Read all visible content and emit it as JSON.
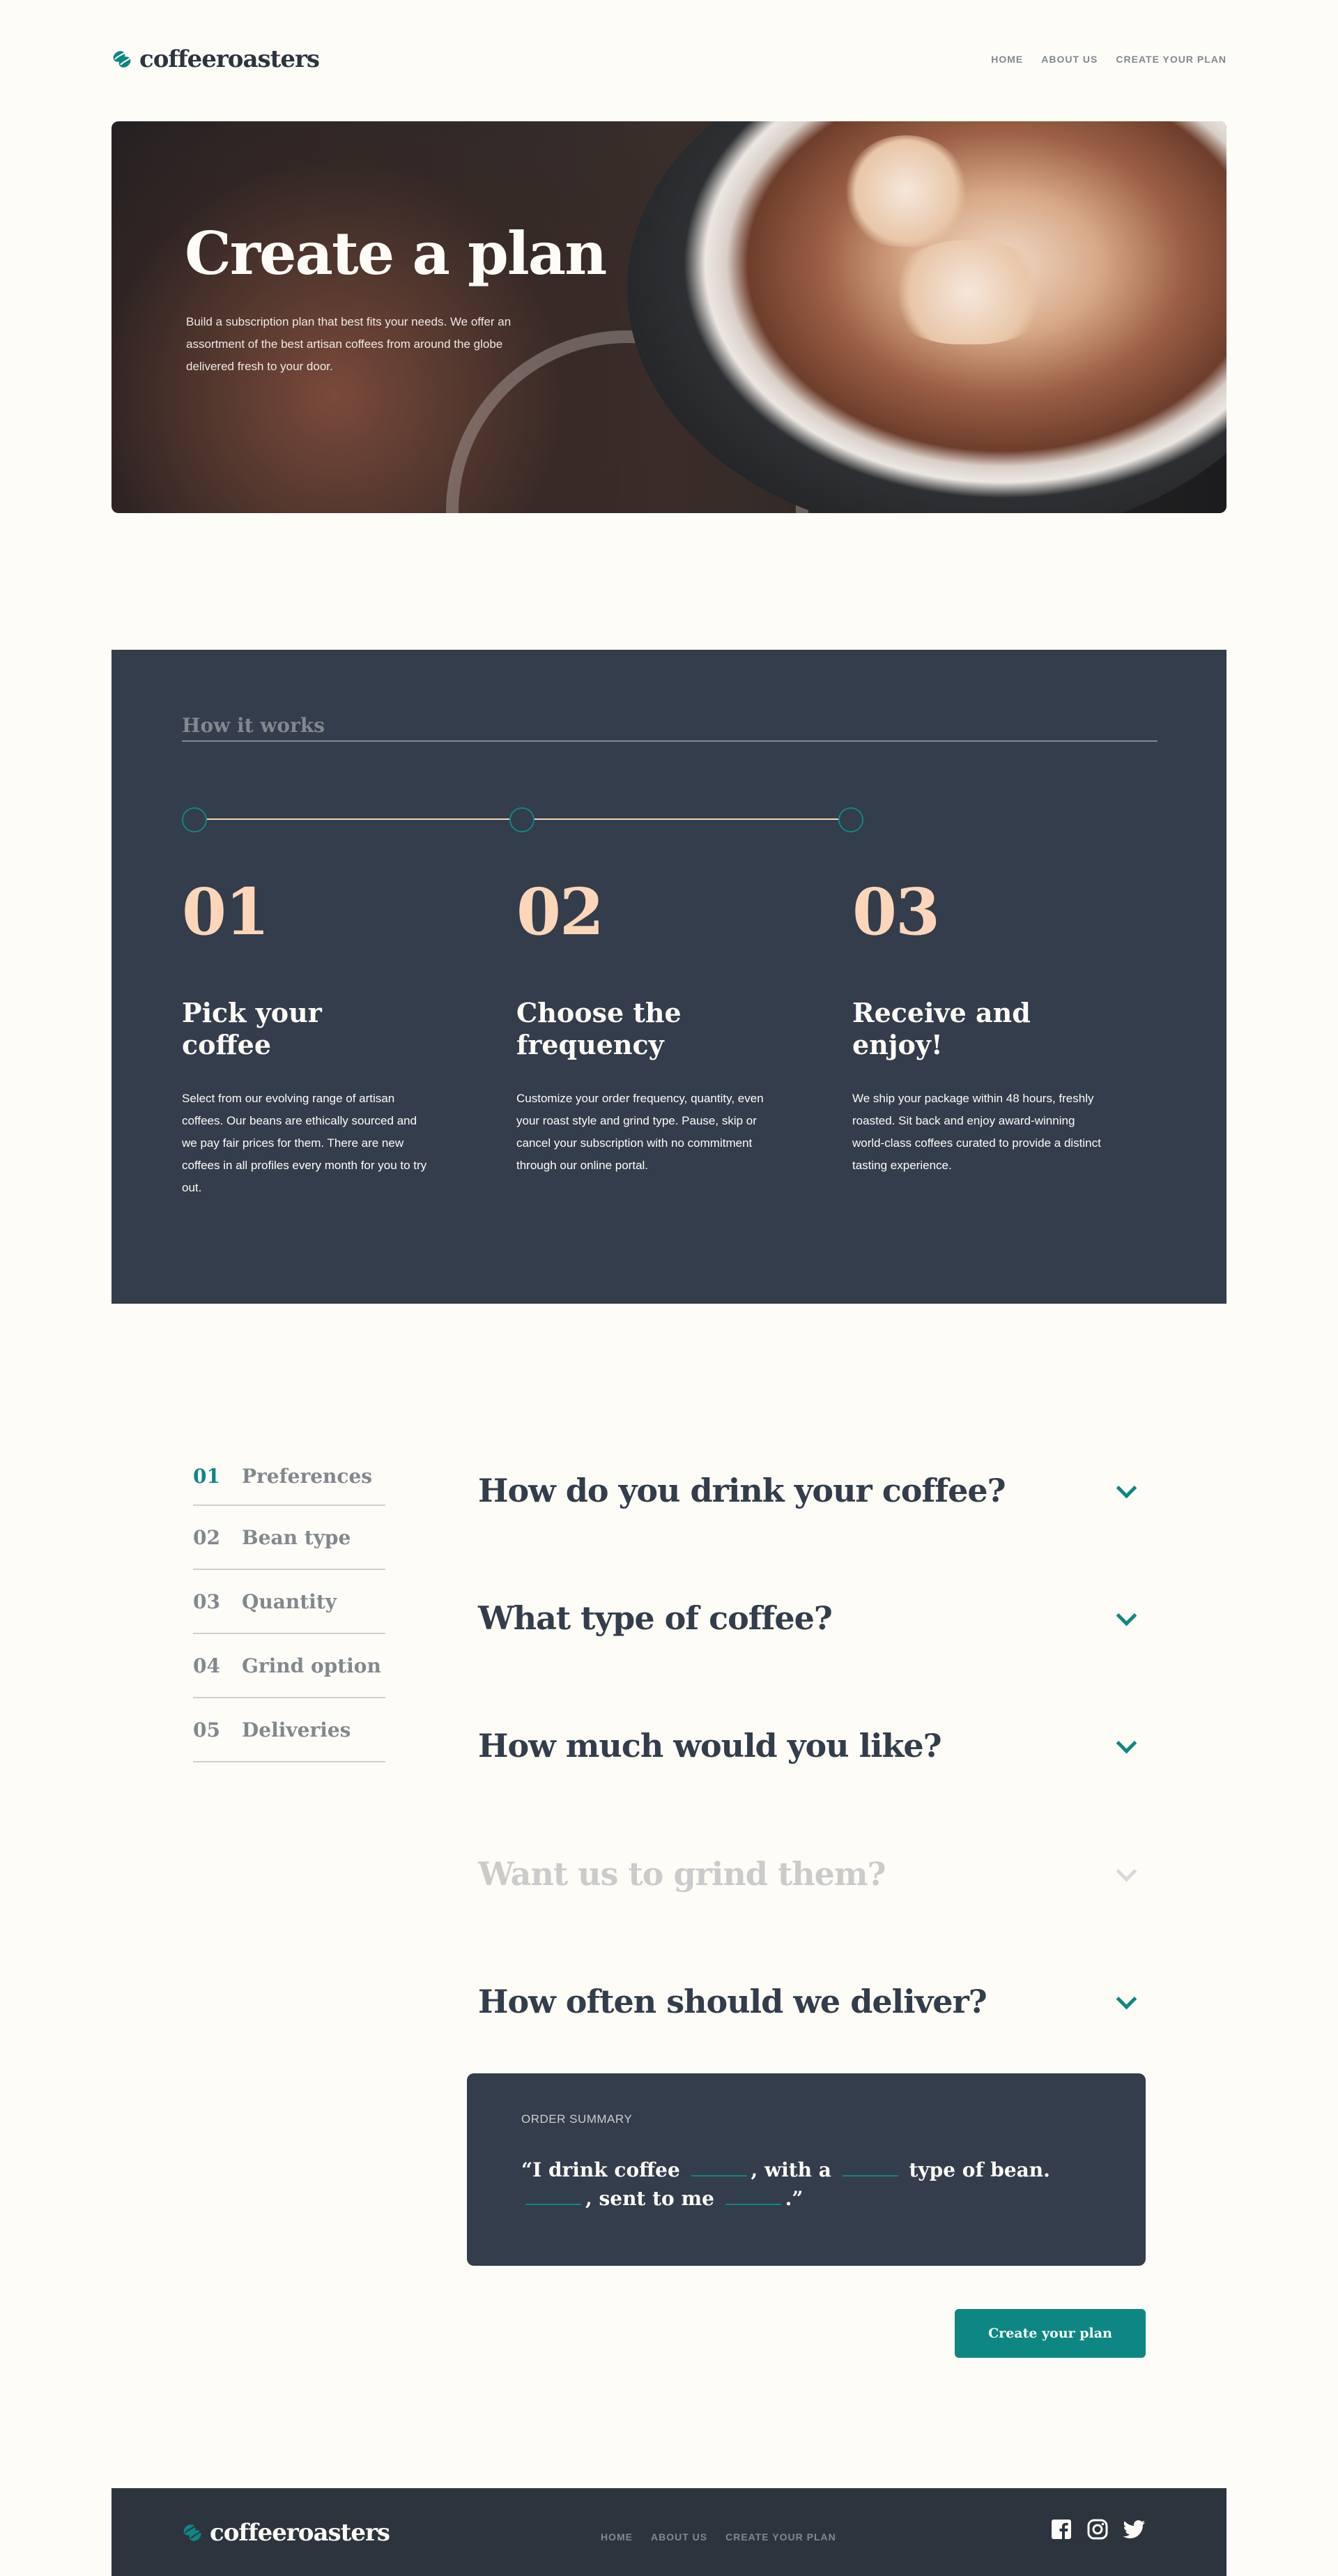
{
  "brand": {
    "name": "coffeeroasters",
    "accent": "#0E8784",
    "dark": "#333D4B",
    "peach": "#FDD6BA"
  },
  "nav": {
    "items": [
      "HOME",
      "ABOUT US",
      "CREATE YOUR PLAN"
    ]
  },
  "hero": {
    "title": "Create a plan",
    "description": "Build a subscription plan that best fits your needs. We offer an assortment of the best artisan coffees from around the globe delivered fresh to your door."
  },
  "how": {
    "title": "How it works",
    "steps": [
      {
        "num": "01",
        "title": "Pick your coffee",
        "desc": "Select from our evolving range of artisan coffees. Our beans are ethically sourced and we pay fair prices for them. There are new coffees in all profiles every month for you to try out."
      },
      {
        "num": "02",
        "title": "Choose the frequency",
        "desc": "Customize your order frequency, quantity, even your roast style and grind type. Pause, skip or cancel your subscription with no commitment through our online portal."
      },
      {
        "num": "03",
        "title": "Receive and enjoy!",
        "desc": "We ship your package within 48 hours, freshly roasted. Sit back and enjoy award-winning world-class coffees curated to provide a distinct tasting experience."
      }
    ]
  },
  "sidebar": {
    "items": [
      {
        "num": "01",
        "label": "Preferences"
      },
      {
        "num": "02",
        "label": "Bean type"
      },
      {
        "num": "03",
        "label": "Quantity"
      },
      {
        "num": "04",
        "label": "Grind option"
      },
      {
        "num": "05",
        "label": "Deliveries"
      }
    ]
  },
  "questions": [
    "How do you drink your coffee?",
    "What type of coffee?",
    "How much would you like?",
    "Want us to grind them?",
    "How often should we deliver?"
  ],
  "order": {
    "label": "ORDER SUMMARY",
    "open_quote": "“I drink coffee",
    "part2": ", with a",
    "part3": "type of bean.",
    "part4": ",",
    "part5": "sent to me",
    "close": ".”",
    "blank": "_____"
  },
  "cta": "Create your plan",
  "footer": {
    "nav": [
      "HOME",
      "ABOUT US",
      "CREATE YOUR PLAN"
    ]
  }
}
